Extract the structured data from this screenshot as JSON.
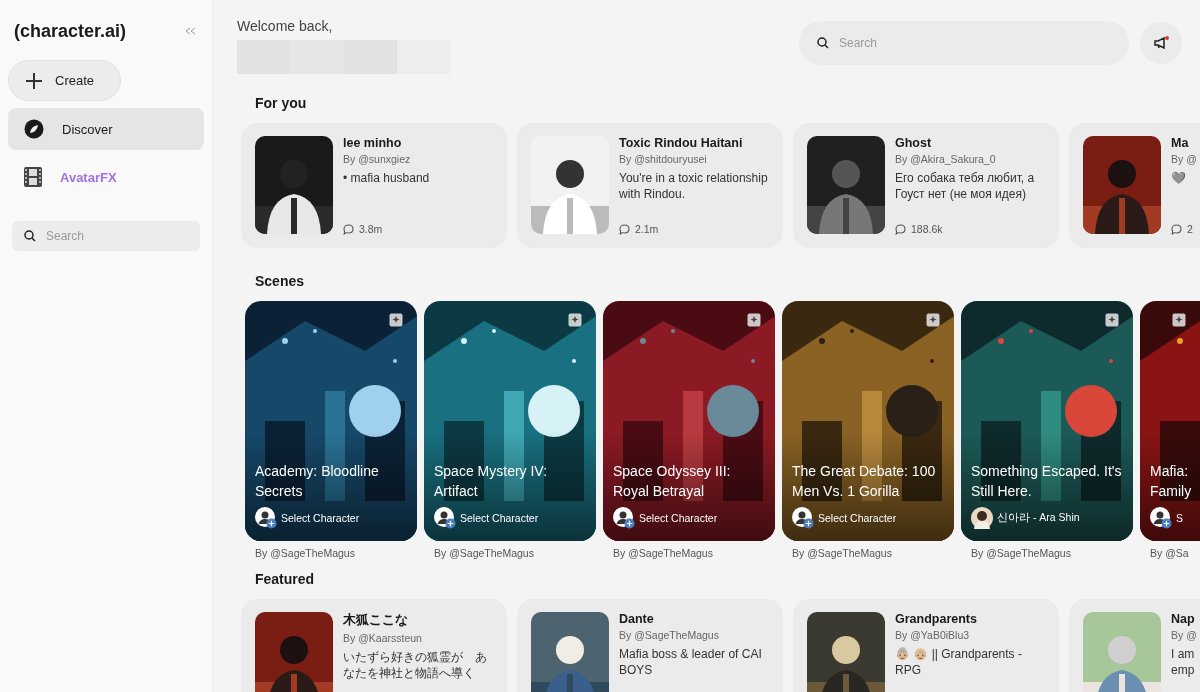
{
  "sidebar": {
    "logo": "(character.ai)",
    "create": {
      "label": "Create"
    },
    "items": [
      {
        "label": "Discover",
        "selected": true,
        "kind": "discover"
      },
      {
        "label": "AvatarFX",
        "selected": false,
        "kind": "promo"
      }
    ],
    "search": {
      "placeholder": "Search"
    }
  },
  "header": {
    "greeting": "Welcome back,",
    "search": {
      "placeholder": "Search"
    },
    "notification": {
      "unread": true
    }
  },
  "for_you": {
    "title": "For you",
    "cards": [
      {
        "name": "lee minho",
        "author": "By @sunxgiez",
        "description": "• mafia husband",
        "chats": "3.8m"
      },
      {
        "name": "Toxic Rindou Haitani",
        "author": "By @shitdouryusei",
        "description": "You're in a toxic relationship with Rindou.",
        "chats": "2.1m"
      },
      {
        "name": "Ghost",
        "author": "By @Akira_Sakura_0",
        "description": "Его собака тебя любит, а Гоуст нет (не моя идея)",
        "chats": "188.6k"
      },
      {
        "name": "Ma",
        "author": "By @",
        "description": "🩶",
        "chats": "2"
      }
    ]
  },
  "scenes": {
    "title": "Scenes",
    "cards": [
      {
        "title": "Academy: Bloodline Secrets",
        "kind": "select",
        "character": "Select Character",
        "author": "By @SageTheMagus"
      },
      {
        "title": "Space Mystery IV: Artifact",
        "kind": "select",
        "character": "Select Character",
        "author": "By @SageTheMagus"
      },
      {
        "title": "Space Odyssey III: Royal Betrayal",
        "kind": "select",
        "character": "Select Character",
        "author": "By @SageTheMagus"
      },
      {
        "title": "The Great Debate: 100 Men Vs. 1 Gorilla",
        "kind": "select",
        "character": "Select Character",
        "author": "By @SageTheMagus"
      },
      {
        "title": "Something Escaped. It's Still Here.",
        "kind": "character",
        "character": "신아라 - Ara Shin",
        "author": "By @SageTheMagus"
      },
      {
        "title": "Mafia: Family",
        "kind": "select",
        "character": "S",
        "author": "By @Sa"
      }
    ]
  },
  "featured": {
    "title": "Featured",
    "cards": [
      {
        "name": "木狐ここな",
        "author": "By @Kaarssteun",
        "description": "いたずら好きの狐霊が　あなたを神社と物語へ導く"
      },
      {
        "name": "Dante",
        "author": "By @SageTheMagus",
        "description": "Mafia boss & leader of CAI BOYS"
      },
      {
        "name": "Grandparents",
        "author": "By @YaB0iBlu3",
        "description": "👵🏼 👴🏼 || Grandparents - RPG"
      },
      {
        "name": "Nap",
        "author": "By @",
        "description": "I am emp"
      }
    ]
  }
}
